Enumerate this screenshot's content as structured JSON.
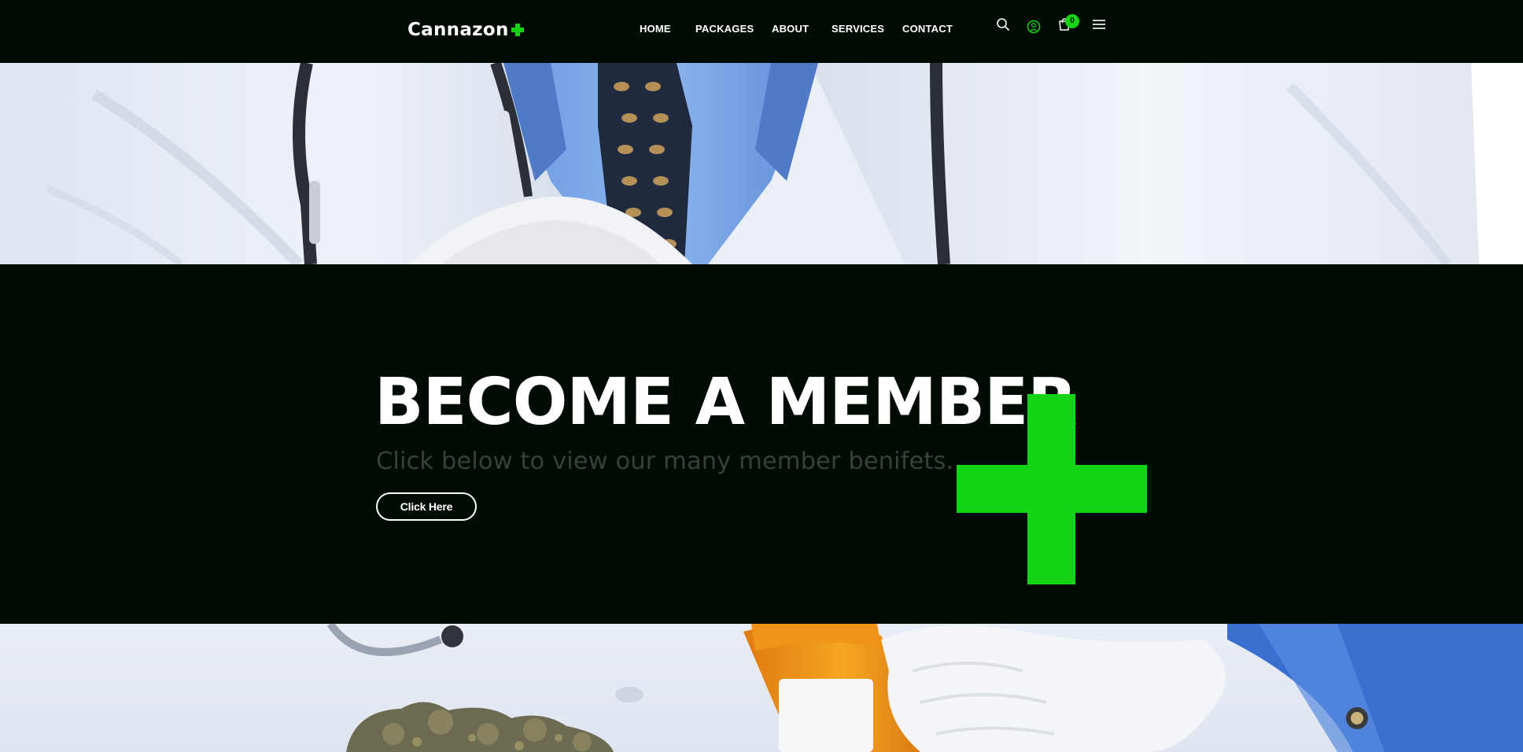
{
  "brand": {
    "name": "Cannazon",
    "accent": "#14d214",
    "background": "#000c03"
  },
  "nav": {
    "links": [
      "HOME",
      "PACKAGES",
      "ABOUT",
      "SERVICES",
      "CONTACT"
    ],
    "icons": [
      "search-icon",
      "user-icon",
      "cart-icon",
      "menu-icon"
    ],
    "cart_count": "0"
  },
  "hero": {
    "top_image": "doctor-coat-stethoscope-photo",
    "bottom_image": "doctor-gloved-hand-pill-bottle-photo"
  },
  "member": {
    "title": "BECOME A MEMBER",
    "subtitle": "Click below to view our many member benifets.",
    "button_label": "Click Here"
  }
}
